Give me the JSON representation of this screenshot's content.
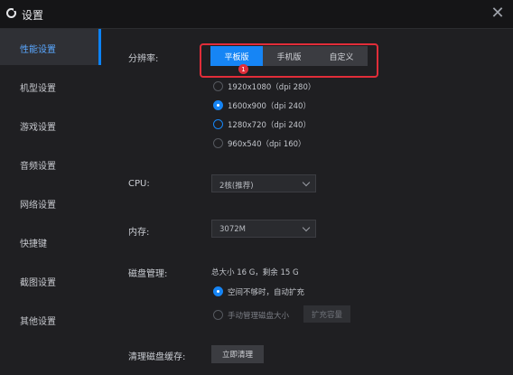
{
  "window": {
    "title": "设置",
    "close_glyph": "✕"
  },
  "sidebar": {
    "items": [
      {
        "label": "性能设置",
        "active": true
      },
      {
        "label": "机型设置"
      },
      {
        "label": "游戏设置"
      },
      {
        "label": "音频设置"
      },
      {
        "label": "网络设置"
      },
      {
        "label": "快捷键"
      },
      {
        "label": "截图设置"
      },
      {
        "label": "其他设置"
      }
    ]
  },
  "resolution": {
    "label": "分辨率:",
    "tabs": [
      "平板版",
      "手机版",
      "自定义"
    ],
    "selected_tab": "平板版",
    "badge": "1",
    "options": [
      {
        "text": "1920x1080（dpi 280）",
        "state": "unchecked"
      },
      {
        "text": "1600x900（dpi 240）",
        "state": "checked"
      },
      {
        "text": "1280x720（dpi 240）",
        "state": "unchecked"
      },
      {
        "text": "960x540（dpi 160）",
        "state": "unchecked"
      }
    ]
  },
  "cpu": {
    "label": "CPU:",
    "value": "2核(推荐)"
  },
  "memory": {
    "label": "内存:",
    "value": "3072M"
  },
  "disk": {
    "label": "磁盘管理:",
    "info": "总大小 16 G，剩余 15 G",
    "options": [
      {
        "text": "空间不够时，自动扩充",
        "state": "checked"
      },
      {
        "text": "手动管理磁盘大小",
        "state": "disabled"
      }
    ],
    "expand_button": "扩充容量"
  },
  "cache": {
    "label": "清理磁盘缓存:",
    "button": "立即清理"
  },
  "colors": {
    "accent": "#1685f5",
    "highlight_border": "#e12d39",
    "background": "#1f1f22"
  }
}
